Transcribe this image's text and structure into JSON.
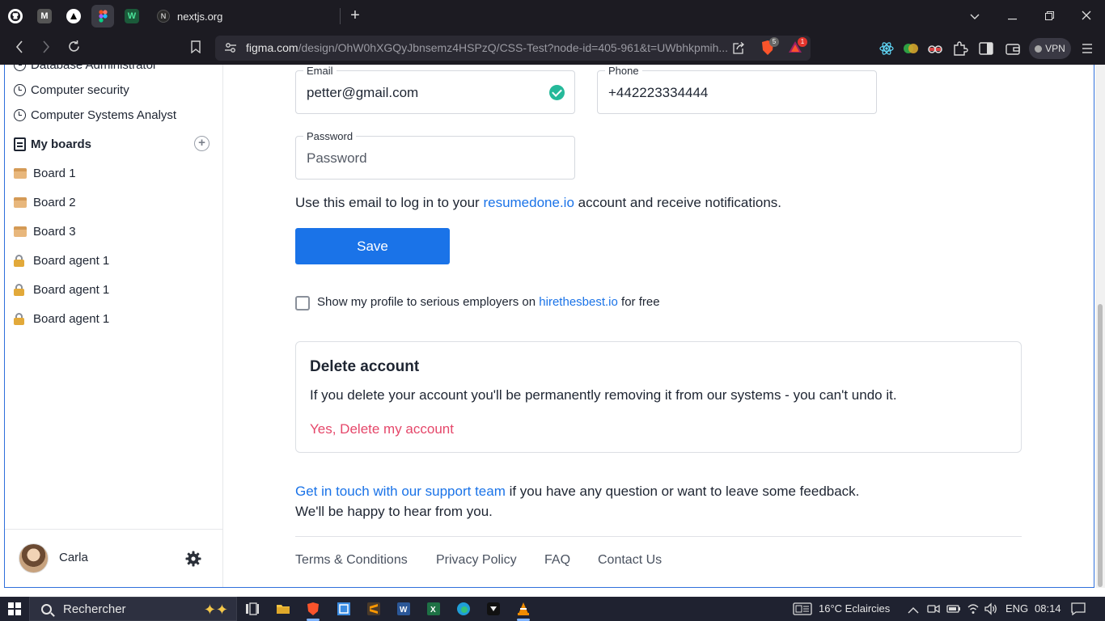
{
  "browser": {
    "active_tab_title": "nextjs.org",
    "url_host": "figma.com",
    "url_path": "/design/OhW0hXGQyJbnsemz4HSPzQ/CSS-Test?node-id=405-961&t=UWbhkpmih...",
    "brave_badge": "5",
    "rewards_badge": "1",
    "vpn_label": "VPN"
  },
  "sidebar": {
    "recent_items": [
      {
        "label": "Database Administrator"
      },
      {
        "label": "Computer security"
      },
      {
        "label": "Computer Systems Analyst"
      }
    ],
    "my_boards_label": "My boards",
    "boards": [
      {
        "label": "Board 1",
        "icon": "folder-icon"
      },
      {
        "label": "Board 2",
        "icon": "folder-icon"
      },
      {
        "label": "Board 3",
        "icon": "folder-icon"
      },
      {
        "label": "Board agent 1",
        "icon": "lock-icon"
      },
      {
        "label": "Board agent 1",
        "icon": "lock-icon"
      },
      {
        "label": "Board agent 1",
        "icon": "lock-icon"
      }
    ],
    "user_name": "Carla"
  },
  "form": {
    "email_label": "Email",
    "email_value": "petter@gmail.com",
    "phone_label": "Phone",
    "phone_value": "+442223334444",
    "password_label": "Password",
    "password_placeholder": "Password",
    "email_note_prefix": "Use this email to log in to your ",
    "email_note_link": "resumedone.io",
    "email_note_suffix": " account and receive notifications.",
    "save_label": "Save",
    "profile_prefix": "Show my profile to serious employers on ",
    "profile_link": "hirethesbest.io",
    "profile_suffix": " for free",
    "profile_checked": false
  },
  "delete_account": {
    "title": "Delete account",
    "description": "If you delete your account you'll be permanently removing it from our systems - you can't undo it.",
    "action_label": "Yes, Delete my account"
  },
  "support": {
    "link": "Get in touch with our support team",
    "suffix": " if you have any question or want to leave some feedback.",
    "line2": "We'll be happy to hear from you."
  },
  "footer": {
    "links": [
      "Terms & Conditions",
      "Privacy Policy",
      "FAQ",
      "Contact Us"
    ]
  },
  "taskbar": {
    "search_placeholder": "Rechercher",
    "weather": "16°C  Eclaircies",
    "language": "ENG",
    "time": "08:14"
  },
  "colors": {
    "accent": "#1a73e8",
    "danger": "#e5476a",
    "success": "#25b99a"
  }
}
